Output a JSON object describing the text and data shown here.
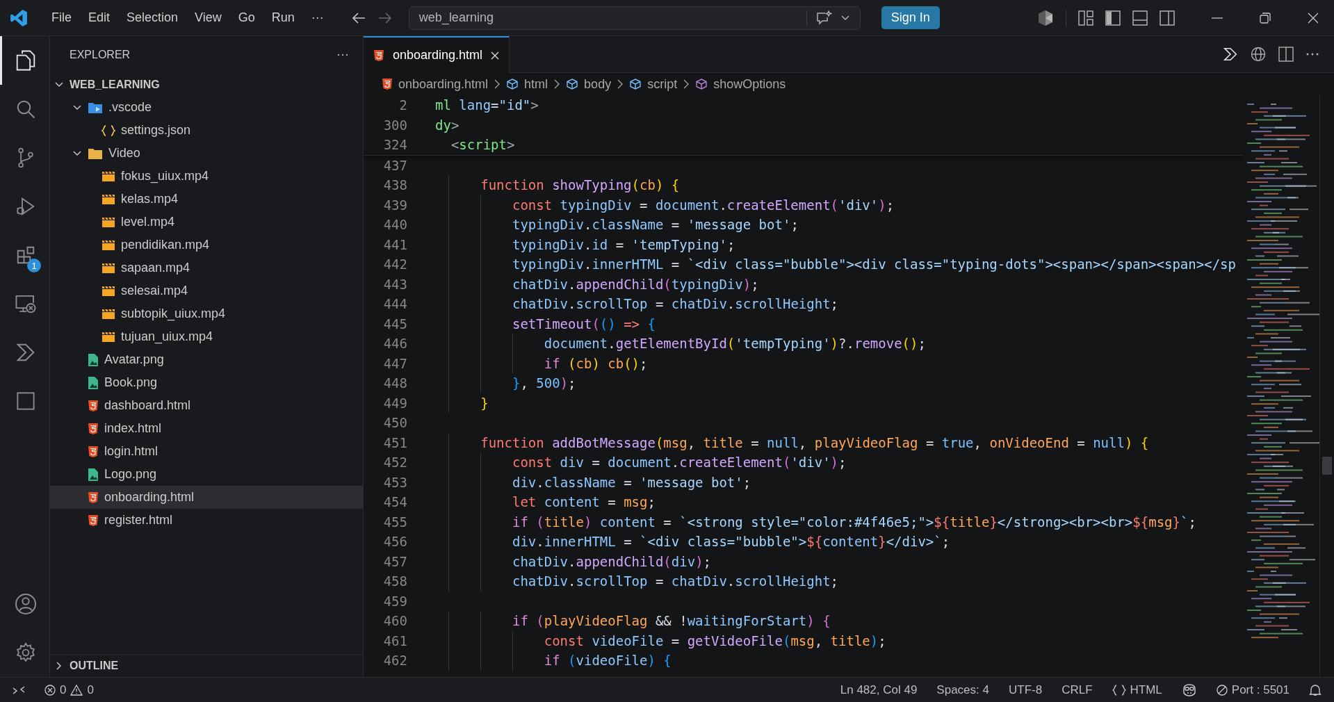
{
  "title_bar": {
    "menu": [
      "File",
      "Edit",
      "Selection",
      "View",
      "Go",
      "Run",
      "···"
    ],
    "command_center": "web_learning",
    "sign_in": "Sign In"
  },
  "activity_bar": {
    "top": [
      {
        "kind": "explorer",
        "selected": true
      },
      {
        "kind": "search",
        "selected": false
      },
      {
        "kind": "source-control",
        "selected": false
      },
      {
        "kind": "run-debug",
        "selected": false
      },
      {
        "kind": "extensions",
        "selected": false,
        "badge": "1"
      },
      {
        "kind": "remote",
        "selected": false
      },
      {
        "kind": "agent",
        "selected": false
      },
      {
        "kind": "panel",
        "selected": false
      }
    ],
    "bottom": [
      {
        "kind": "account"
      },
      {
        "kind": "settings"
      }
    ]
  },
  "explorer": {
    "title": "EXPLORER",
    "more": "···",
    "root": {
      "label": "WEB_LEARNING",
      "expanded": true,
      "children": [
        {
          "label": ".vscode",
          "kind": "folder-vscode",
          "expanded": true,
          "selected": false,
          "children": [
            {
              "label": "settings.json",
              "kind": "json",
              "selected": false
            }
          ]
        },
        {
          "label": "Video",
          "kind": "folder",
          "expanded": true,
          "selected": false,
          "children": [
            {
              "label": "fokus_uiux.mp4",
              "kind": "video",
              "selected": false
            },
            {
              "label": "kelas.mp4",
              "kind": "video",
              "selected": false
            },
            {
              "label": "level.mp4",
              "kind": "video",
              "selected": false
            },
            {
              "label": "pendidikan.mp4",
              "kind": "video",
              "selected": false
            },
            {
              "label": "sapaan.mp4",
              "kind": "video",
              "selected": false
            },
            {
              "label": "selesai.mp4",
              "kind": "video",
              "selected": false
            },
            {
              "label": "subtopik_uiux.mp4",
              "kind": "video",
              "selected": false
            },
            {
              "label": "tujuan_uiux.mp4",
              "kind": "video",
              "selected": false
            }
          ]
        },
        {
          "label": "Avatar.png",
          "kind": "image",
          "selected": false
        },
        {
          "label": "Book.png",
          "kind": "image",
          "selected": false
        },
        {
          "label": "dashboard.html",
          "kind": "html",
          "selected": false
        },
        {
          "label": "index.html",
          "kind": "html",
          "selected": false
        },
        {
          "label": "login.html",
          "kind": "html",
          "selected": false
        },
        {
          "label": "Logo.png",
          "kind": "image",
          "selected": false
        },
        {
          "label": "onboarding.html",
          "kind": "html",
          "selected": true
        },
        {
          "label": "register.html",
          "kind": "html",
          "selected": false
        }
      ]
    },
    "outline": {
      "label": "OUTLINE",
      "expanded": false
    }
  },
  "tabs": [
    {
      "label": "onboarding.html",
      "selected": true
    }
  ],
  "breadcrumbs": [
    {
      "label": "onboarding.html",
      "kind": "file"
    },
    {
      "label": "html",
      "kind": "element"
    },
    {
      "label": "body",
      "kind": "element"
    },
    {
      "label": "script",
      "kind": "element"
    },
    {
      "label": "showOptions",
      "kind": "method"
    }
  ],
  "sticky_lines": [
    {
      "number": "2",
      "tokens": [
        {
          "kind": "tag",
          "text": "ml "
        },
        {
          "kind": "attr",
          "text": "lang"
        },
        {
          "kind": "plain",
          "text": "="
        },
        {
          "kind": "string",
          "text": "\"id\""
        },
        {
          "kind": "punct",
          "text": ">"
        }
      ]
    },
    {
      "number": "300",
      "tokens": [
        {
          "kind": "tag",
          "text": "dy"
        },
        {
          "kind": "punct",
          "text": ">"
        }
      ]
    },
    {
      "number": "324",
      "tokens": [
        {
          "kind": "punct",
          "text": "  <"
        },
        {
          "kind": "tag",
          "text": "script"
        },
        {
          "kind": "punct",
          "text": ">"
        }
      ]
    }
  ],
  "code_lines": [
    {
      "number": "437"
    },
    {
      "number": "438",
      "tokens": [
        {
          "kind": "keyword",
          "text": "        function "
        },
        {
          "kind": "function",
          "text": "showTyping"
        },
        {
          "kind": "bracket1",
          "text": "("
        },
        {
          "kind": "parameter",
          "text": "cb"
        },
        {
          "kind": "bracket1",
          "text": ") "
        },
        {
          "kind": "bracket1",
          "text": "{"
        }
      ]
    },
    {
      "number": "439",
      "tokens": [
        {
          "kind": "keyword",
          "text": "            const "
        },
        {
          "kind": "variable",
          "text": "typingDiv"
        },
        {
          "kind": "plain",
          "text": " = "
        },
        {
          "kind": "variable",
          "text": "document"
        },
        {
          "kind": "plain",
          "text": "."
        },
        {
          "kind": "function",
          "text": "createElement"
        },
        {
          "kind": "bracket2",
          "text": "("
        },
        {
          "kind": "string",
          "text": "'div'"
        },
        {
          "kind": "bracket2",
          "text": ")"
        },
        {
          "kind": "plain",
          "text": ";"
        }
      ]
    },
    {
      "number": "440",
      "tokens": [
        {
          "kind": "variable",
          "text": "            typingDiv"
        },
        {
          "kind": "plain",
          "text": "."
        },
        {
          "kind": "variable",
          "text": "className"
        },
        {
          "kind": "plain",
          "text": " = "
        },
        {
          "kind": "string",
          "text": "'message bot'"
        },
        {
          "kind": "plain",
          "text": ";"
        }
      ]
    },
    {
      "number": "441",
      "tokens": [
        {
          "kind": "variable",
          "text": "            typingDiv"
        },
        {
          "kind": "plain",
          "text": "."
        },
        {
          "kind": "variable",
          "text": "id"
        },
        {
          "kind": "plain",
          "text": " = "
        },
        {
          "kind": "string",
          "text": "'tempTyping'"
        },
        {
          "kind": "plain",
          "text": ";"
        }
      ]
    },
    {
      "number": "442",
      "tokens": [
        {
          "kind": "variable",
          "text": "            typingDiv"
        },
        {
          "kind": "plain",
          "text": "."
        },
        {
          "kind": "variable",
          "text": "innerHTML"
        },
        {
          "kind": "plain",
          "text": " = "
        },
        {
          "kind": "string",
          "text": "`<div class=\"bubble\"><div class=\"typing-dots\"><span></span><span></sp"
        }
      ]
    },
    {
      "number": "443",
      "tokens": [
        {
          "kind": "variable",
          "text": "            chatDiv"
        },
        {
          "kind": "plain",
          "text": "."
        },
        {
          "kind": "function",
          "text": "appendChild"
        },
        {
          "kind": "bracket2",
          "text": "("
        },
        {
          "kind": "variable",
          "text": "typingDiv"
        },
        {
          "kind": "bracket2",
          "text": ")"
        },
        {
          "kind": "plain",
          "text": ";"
        }
      ]
    },
    {
      "number": "444",
      "tokens": [
        {
          "kind": "variable",
          "text": "            chatDiv"
        },
        {
          "kind": "plain",
          "text": "."
        },
        {
          "kind": "variable",
          "text": "scrollTop"
        },
        {
          "kind": "plain",
          "text": " = "
        },
        {
          "kind": "variable",
          "text": "chatDiv"
        },
        {
          "kind": "plain",
          "text": "."
        },
        {
          "kind": "variable",
          "text": "scrollHeight"
        },
        {
          "kind": "plain",
          "text": ";"
        }
      ]
    },
    {
      "number": "445",
      "tokens": [
        {
          "kind": "function",
          "text": "            setTimeout"
        },
        {
          "kind": "bracket2",
          "text": "("
        },
        {
          "kind": "bracket3",
          "text": "() "
        },
        {
          "kind": "keyword",
          "text": "=> "
        },
        {
          "kind": "bracket3",
          "text": "{"
        }
      ]
    },
    {
      "number": "446",
      "tokens": [
        {
          "kind": "variable",
          "text": "                document"
        },
        {
          "kind": "plain",
          "text": "."
        },
        {
          "kind": "function",
          "text": "getElementById"
        },
        {
          "kind": "bracket1",
          "text": "("
        },
        {
          "kind": "string",
          "text": "'tempTyping'"
        },
        {
          "kind": "bracket1",
          "text": ")"
        },
        {
          "kind": "plain",
          "text": "?."
        },
        {
          "kind": "function",
          "text": "remove"
        },
        {
          "kind": "bracket1",
          "text": "()"
        },
        {
          "kind": "plain",
          "text": ";"
        }
      ]
    },
    {
      "number": "447",
      "tokens": [
        {
          "kind": "control",
          "text": "                if "
        },
        {
          "kind": "bracket1",
          "text": "("
        },
        {
          "kind": "parameter",
          "text": "cb"
        },
        {
          "kind": "bracket1",
          "text": ") "
        },
        {
          "kind": "parameter",
          "text": "cb"
        },
        {
          "kind": "bracket1",
          "text": "()"
        },
        {
          "kind": "plain",
          "text": ";"
        }
      ]
    },
    {
      "number": "448",
      "tokens": [
        {
          "kind": "bracket3",
          "text": "            }"
        },
        {
          "kind": "plain",
          "text": ", "
        },
        {
          "kind": "constant",
          "text": "500"
        },
        {
          "kind": "bracket2",
          "text": ")"
        },
        {
          "kind": "plain",
          "text": ";"
        }
      ]
    },
    {
      "number": "449",
      "tokens": [
        {
          "kind": "bracket1",
          "text": "        }"
        }
      ]
    },
    {
      "number": "450"
    },
    {
      "number": "451",
      "tokens": [
        {
          "kind": "keyword",
          "text": "        function "
        },
        {
          "kind": "function",
          "text": "addBotMessage"
        },
        {
          "kind": "bracket1",
          "text": "("
        },
        {
          "kind": "parameter",
          "text": "msg"
        },
        {
          "kind": "plain",
          "text": ", "
        },
        {
          "kind": "parameter",
          "text": "title"
        },
        {
          "kind": "plain",
          "text": " = "
        },
        {
          "kind": "constant",
          "text": "null"
        },
        {
          "kind": "plain",
          "text": ", "
        },
        {
          "kind": "parameter",
          "text": "playVideoFlag"
        },
        {
          "kind": "plain",
          "text": " = "
        },
        {
          "kind": "constant",
          "text": "true"
        },
        {
          "kind": "plain",
          "text": ", "
        },
        {
          "kind": "parameter",
          "text": "onVideoEnd"
        },
        {
          "kind": "plain",
          "text": " = "
        },
        {
          "kind": "constant",
          "text": "null"
        },
        {
          "kind": "bracket1",
          "text": ") "
        },
        {
          "kind": "bracket1",
          "text": "{"
        }
      ]
    },
    {
      "number": "452",
      "tokens": [
        {
          "kind": "keyword",
          "text": "            const "
        },
        {
          "kind": "variable",
          "text": "div"
        },
        {
          "kind": "plain",
          "text": " = "
        },
        {
          "kind": "variable",
          "text": "document"
        },
        {
          "kind": "plain",
          "text": "."
        },
        {
          "kind": "function",
          "text": "createElement"
        },
        {
          "kind": "bracket2",
          "text": "("
        },
        {
          "kind": "string",
          "text": "'div'"
        },
        {
          "kind": "bracket2",
          "text": ")"
        },
        {
          "kind": "plain",
          "text": ";"
        }
      ]
    },
    {
      "number": "453",
      "tokens": [
        {
          "kind": "variable",
          "text": "            div"
        },
        {
          "kind": "plain",
          "text": "."
        },
        {
          "kind": "variable",
          "text": "className"
        },
        {
          "kind": "plain",
          "text": " = "
        },
        {
          "kind": "string",
          "text": "'message bot'"
        },
        {
          "kind": "plain",
          "text": ";"
        }
      ]
    },
    {
      "number": "454",
      "tokens": [
        {
          "kind": "keyword",
          "text": "            let "
        },
        {
          "kind": "variable",
          "text": "content"
        },
        {
          "kind": "plain",
          "text": " = "
        },
        {
          "kind": "parameter",
          "text": "msg"
        },
        {
          "kind": "plain",
          "text": ";"
        }
      ]
    },
    {
      "number": "455",
      "tokens": [
        {
          "kind": "control",
          "text": "            if "
        },
        {
          "kind": "bracket2",
          "text": "("
        },
        {
          "kind": "parameter",
          "text": "title"
        },
        {
          "kind": "bracket2",
          "text": ") "
        },
        {
          "kind": "variable",
          "text": "content"
        },
        {
          "kind": "plain",
          "text": " = "
        },
        {
          "kind": "string",
          "text": "`<strong style=\"color:#4f46e5;\">"
        },
        {
          "kind": "keyword",
          "text": "${"
        },
        {
          "kind": "parameter",
          "text": "title"
        },
        {
          "kind": "keyword",
          "text": "}"
        },
        {
          "kind": "string",
          "text": "</strong><br><br>"
        },
        {
          "kind": "keyword",
          "text": "${"
        },
        {
          "kind": "parameter",
          "text": "msg"
        },
        {
          "kind": "keyword",
          "text": "}"
        },
        {
          "kind": "string",
          "text": "`"
        },
        {
          "kind": "plain",
          "text": ";"
        }
      ]
    },
    {
      "number": "456",
      "tokens": [
        {
          "kind": "variable",
          "text": "            div"
        },
        {
          "kind": "plain",
          "text": "."
        },
        {
          "kind": "variable",
          "text": "innerHTML"
        },
        {
          "kind": "plain",
          "text": " = "
        },
        {
          "kind": "string",
          "text": "`<div class=\"bubble\">"
        },
        {
          "kind": "keyword",
          "text": "${"
        },
        {
          "kind": "variable",
          "text": "content"
        },
        {
          "kind": "keyword",
          "text": "}"
        },
        {
          "kind": "string",
          "text": "</div>`"
        },
        {
          "kind": "plain",
          "text": ";"
        }
      ]
    },
    {
      "number": "457",
      "tokens": [
        {
          "kind": "variable",
          "text": "            chatDiv"
        },
        {
          "kind": "plain",
          "text": "."
        },
        {
          "kind": "function",
          "text": "appendChild"
        },
        {
          "kind": "bracket2",
          "text": "("
        },
        {
          "kind": "variable",
          "text": "div"
        },
        {
          "kind": "bracket2",
          "text": ")"
        },
        {
          "kind": "plain",
          "text": ";"
        }
      ]
    },
    {
      "number": "458",
      "tokens": [
        {
          "kind": "variable",
          "text": "            chatDiv"
        },
        {
          "kind": "plain",
          "text": "."
        },
        {
          "kind": "variable",
          "text": "scrollTop"
        },
        {
          "kind": "plain",
          "text": " = "
        },
        {
          "kind": "variable",
          "text": "chatDiv"
        },
        {
          "kind": "plain",
          "text": "."
        },
        {
          "kind": "variable",
          "text": "scrollHeight"
        },
        {
          "kind": "plain",
          "text": ";"
        }
      ]
    },
    {
      "number": "459"
    },
    {
      "number": "460",
      "tokens": [
        {
          "kind": "control",
          "text": "            if "
        },
        {
          "kind": "bracket2",
          "text": "("
        },
        {
          "kind": "parameter",
          "text": "playVideoFlag"
        },
        {
          "kind": "plain",
          "text": " && !"
        },
        {
          "kind": "variable",
          "text": "waitingForStart"
        },
        {
          "kind": "bracket2",
          "text": ") "
        },
        {
          "kind": "bracket2",
          "text": "{"
        }
      ]
    },
    {
      "number": "461",
      "tokens": [
        {
          "kind": "keyword",
          "text": "                const "
        },
        {
          "kind": "variable",
          "text": "videoFile"
        },
        {
          "kind": "plain",
          "text": " = "
        },
        {
          "kind": "function",
          "text": "getVideoFile"
        },
        {
          "kind": "bracket3",
          "text": "("
        },
        {
          "kind": "parameter",
          "text": "msg"
        },
        {
          "kind": "plain",
          "text": ", "
        },
        {
          "kind": "parameter",
          "text": "title"
        },
        {
          "kind": "bracket3",
          "text": ")"
        },
        {
          "kind": "plain",
          "text": ";"
        }
      ]
    },
    {
      "number": "462",
      "tokens": [
        {
          "kind": "control",
          "text": "                if "
        },
        {
          "kind": "bracket3",
          "text": "("
        },
        {
          "kind": "variable",
          "text": "videoFile"
        },
        {
          "kind": "bracket3",
          "text": ") "
        },
        {
          "kind": "bracket3",
          "text": "{"
        }
      ]
    }
  ],
  "status_bar": {
    "errors": "0",
    "warnings": "0",
    "position": "Ln 482, Col 49",
    "spaces": "Spaces: 4",
    "encoding": "UTF-8",
    "eol": "CRLF",
    "language": "HTML",
    "port": "Port : 5501"
  }
}
